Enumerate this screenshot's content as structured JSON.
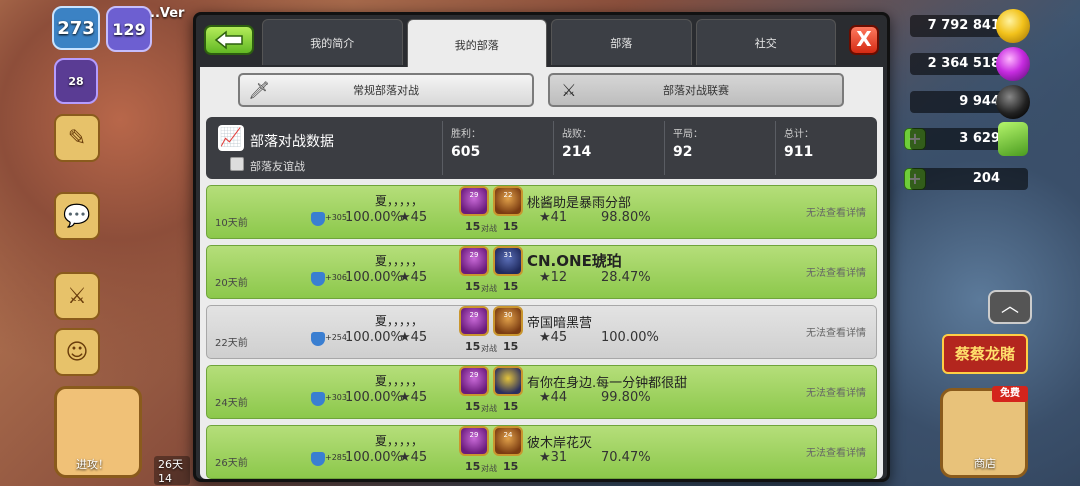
{
  "hud": {
    "xp_level": "273",
    "townhall_level": "129",
    "player_name": "..Ver",
    "league_level": "28",
    "gold": "7 792 841",
    "elixir": "2 364 518",
    "dark_elixir": "9 944",
    "gems": "3 629",
    "builder_count": "204",
    "event_banner": "蔡蔡龙賭",
    "shop_free": "免费",
    "shop_label": "商店",
    "attack_label": "进攻！",
    "small_label": "26天 14"
  },
  "modal": {
    "tabs": [
      {
        "label": "我的简介"
      },
      {
        "label": "我的部落"
      },
      {
        "label": "部落"
      },
      {
        "label": "社交"
      }
    ],
    "close_label": "X",
    "subtabs": {
      "regular": "常规部落对战",
      "league": "部落对战联赛"
    },
    "stats": {
      "title": "部落对战数据",
      "friendly_label": "部落友谊战",
      "wins_label": "胜利：",
      "wins": "605",
      "losses_label": "战败：",
      "losses": "214",
      "draws_label": "平局：",
      "draws": "92",
      "total_label": "总计：",
      "total": "911"
    },
    "wars": [
      {
        "date": "10天前",
        "trophy": "+305",
        "our_name": "夏，，，，，",
        "our_pct": "100.00%",
        "our_stars": "45",
        "our_badge": "29",
        "opp_badge": "22",
        "size_l": "15",
        "vs": "对战",
        "size_r": "15",
        "opp_name": "桃酱助是暴雨分部",
        "opp_stars": "41",
        "opp_pct": "98.80%",
        "details": "无法查看详情"
      },
      {
        "date": "20天前",
        "trophy": "+306",
        "our_name": "夏，，，，，",
        "our_pct": "100.00%",
        "our_stars": "45",
        "our_badge": "29",
        "opp_badge": "31",
        "size_l": "15",
        "vs": "对战",
        "size_r": "15",
        "opp_name": "CN.ONE琥珀",
        "opp_stars": "12",
        "opp_pct": "28.47%",
        "details": "无法查看详情"
      },
      {
        "date": "22天前",
        "trophy": "+254",
        "our_name": "夏，，，，，",
        "our_pct": "100.00%",
        "our_stars": "45",
        "our_badge": "29",
        "opp_badge": "30",
        "size_l": "15",
        "vs": "对战",
        "size_r": "15",
        "opp_name": "帝国暗黑营",
        "opp_stars": "45",
        "opp_pct": "100.00%",
        "details": "无法查看详情"
      },
      {
        "date": "24天前",
        "trophy": "+303",
        "our_name": "夏，，，，，",
        "our_pct": "100.00%",
        "our_stars": "45",
        "our_badge": "29",
        "opp_badge": "",
        "size_l": "15",
        "vs": "对战",
        "size_r": "15",
        "opp_name": "有你在身边.每一分钟都很甜",
        "opp_stars": "44",
        "opp_pct": "99.80%",
        "details": "无法查看详情"
      },
      {
        "date": "26天前",
        "trophy": "+285",
        "our_name": "夏，，，，，",
        "our_pct": "100.00%",
        "our_stars": "45",
        "our_badge": "29",
        "opp_badge": "24",
        "size_l": "15",
        "vs": "对战",
        "size_r": "15",
        "opp_name": "彼木岸花灭",
        "opp_stars": "31",
        "opp_pct": "70.47%",
        "details": "无法查看详情"
      }
    ]
  }
}
